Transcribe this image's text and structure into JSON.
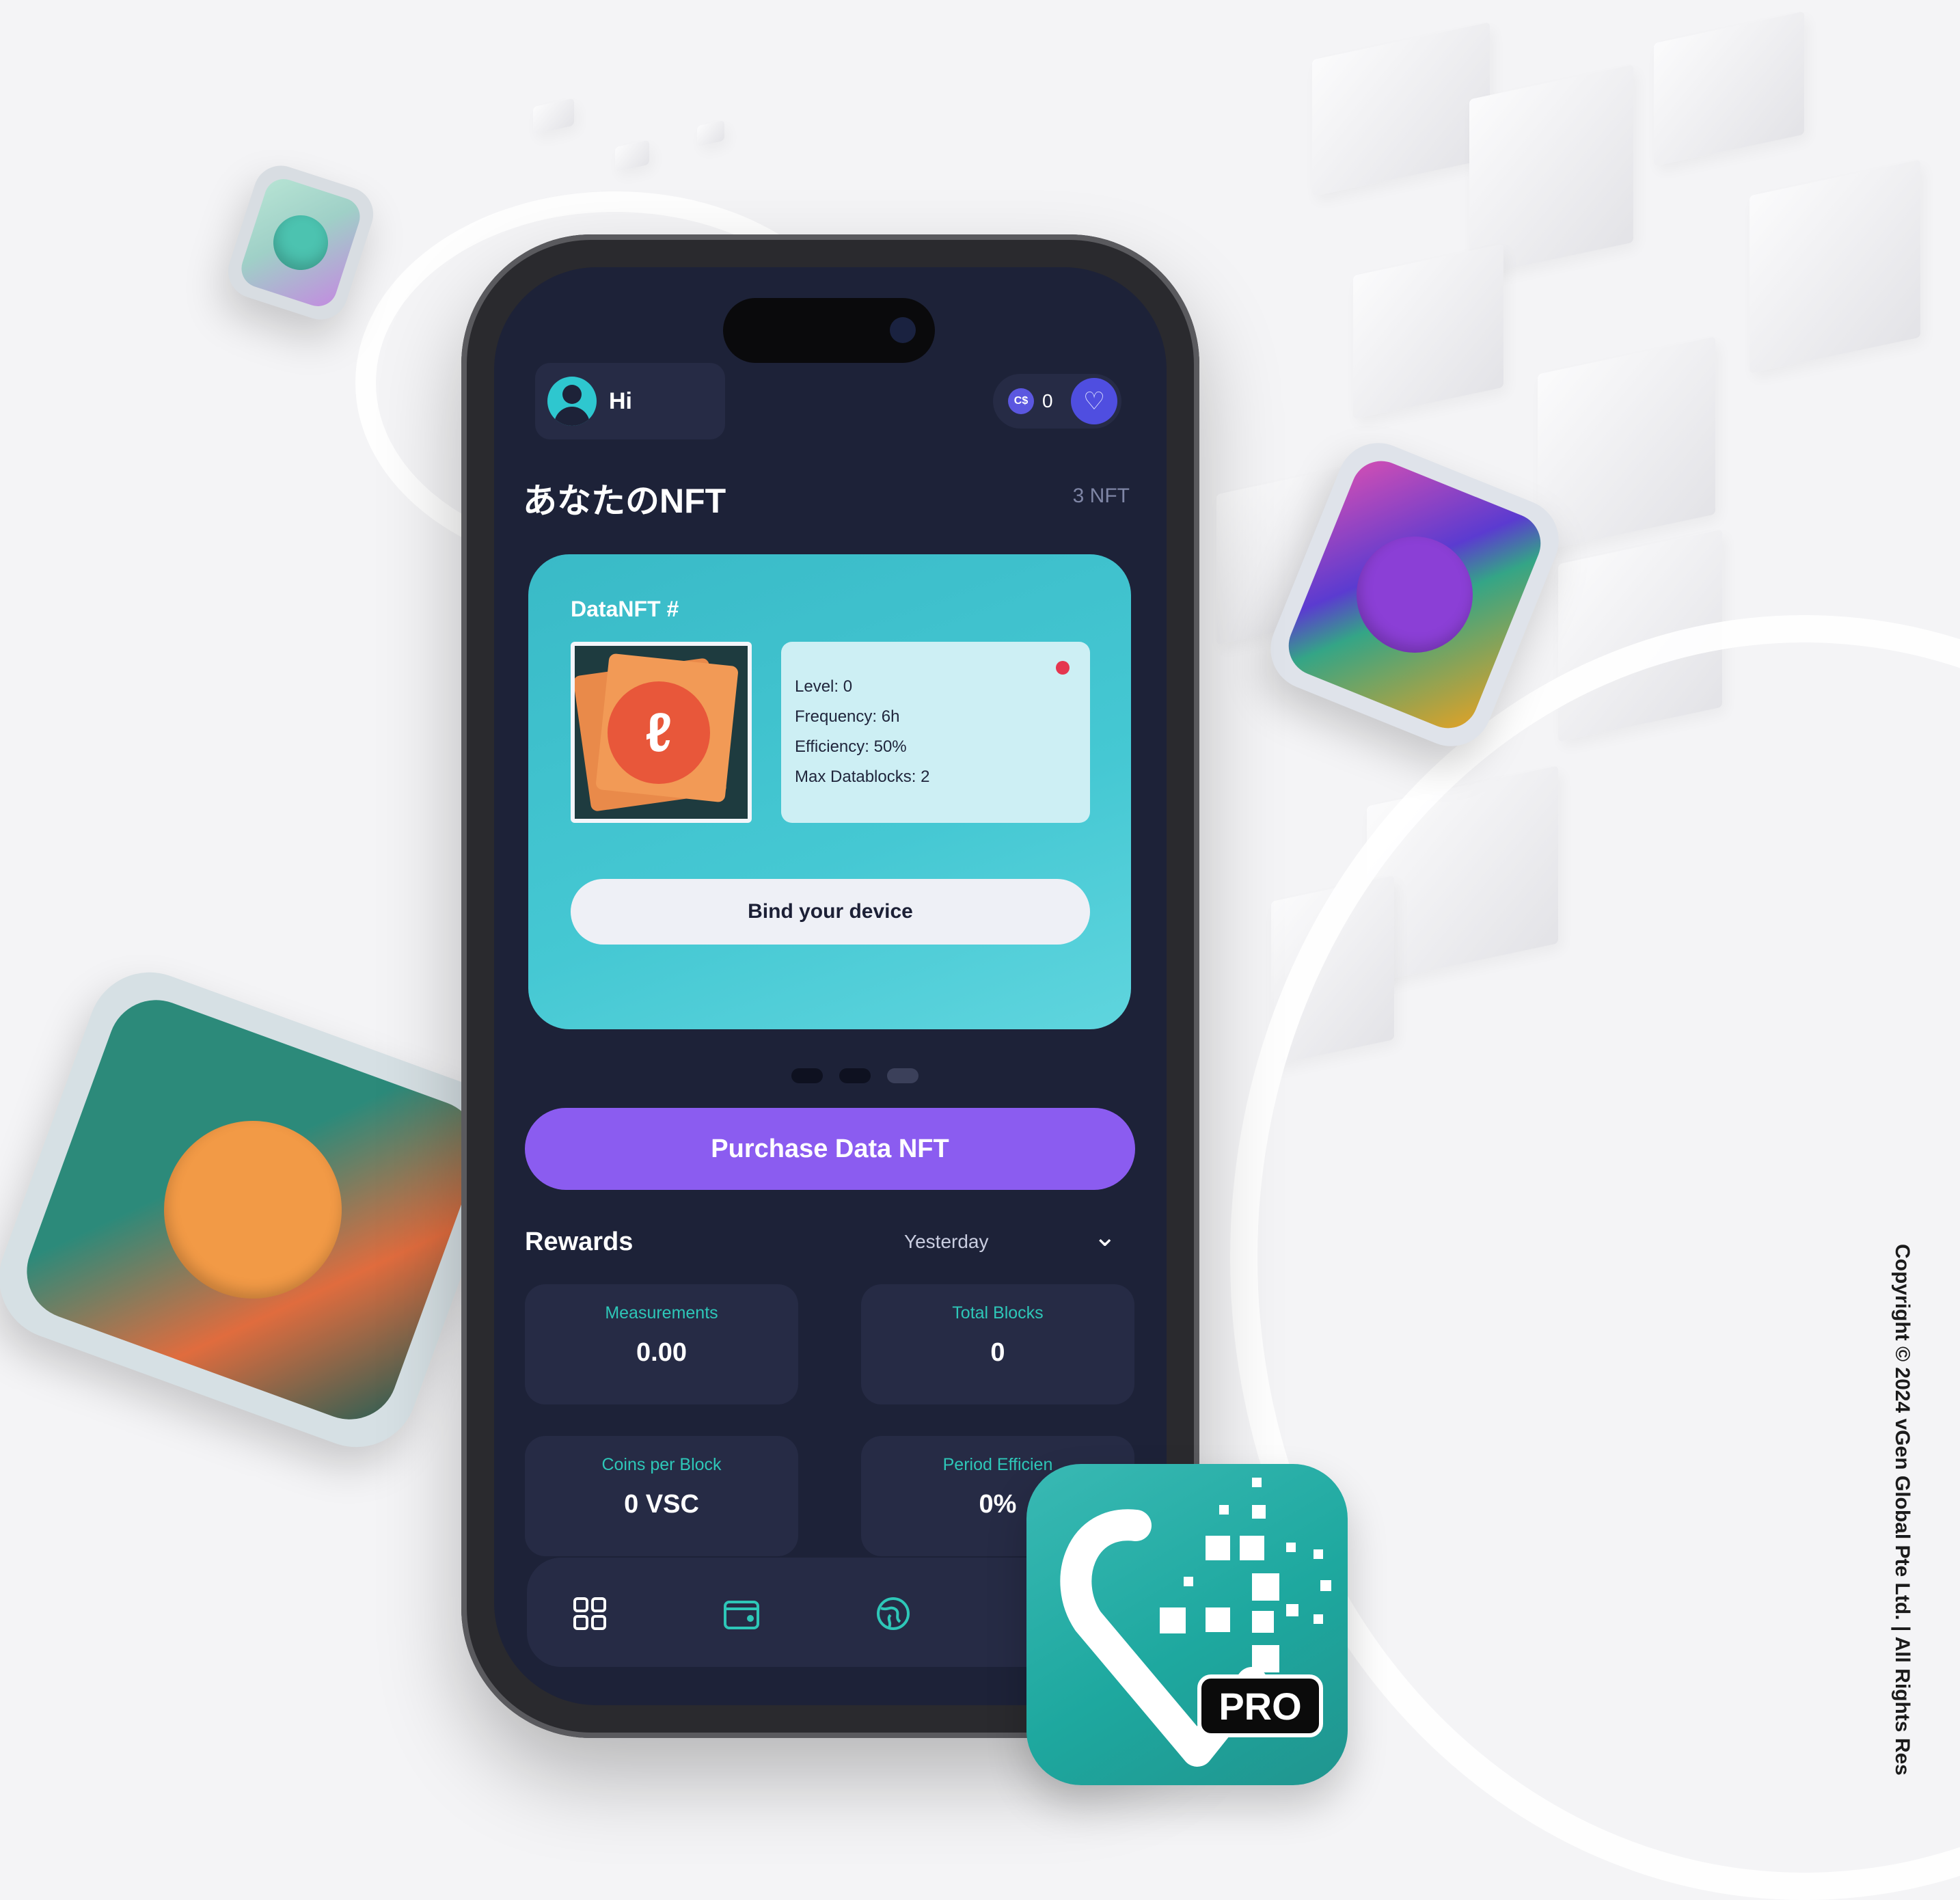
{
  "status": {
    "greeting": "Hi",
    "coin_icon": "C$",
    "coin_balance": "0"
  },
  "nft_section": {
    "title": "あなたのNFT",
    "count": "3 NFT"
  },
  "nft_card": {
    "title": "DataNFT #",
    "stats": [
      "Level: 0",
      "Frequency: 6h",
      "Efficiency: 50%",
      "Max Datablocks: 2"
    ],
    "bind_label": "Bind your device"
  },
  "carousel": {
    "pages": 3,
    "active_index": 2
  },
  "purchase_label": "Purchase Data NFT",
  "rewards": {
    "title": "Rewards",
    "period": "Yesterday",
    "tiles": [
      {
        "label": "Measurements",
        "value": "0.00"
      },
      {
        "label": "Total Blocks",
        "value": "0"
      },
      {
        "label": "Coins per Block",
        "value": "0 VSC"
      },
      {
        "label": "Period Efficien",
        "value": "0%"
      }
    ]
  },
  "nav": {
    "icons": [
      "grid-icon",
      "wallet-icon",
      "globe-icon"
    ]
  },
  "app_icon": {
    "badge": "PRO"
  },
  "copyright": "Copyright © 2024 vGen Global Pte Ltd. | All Rights Res",
  "colors": {
    "accent_purple": "#8b5cf0",
    "teal": "#45c8d3",
    "screen_bg": "#1d2238"
  }
}
